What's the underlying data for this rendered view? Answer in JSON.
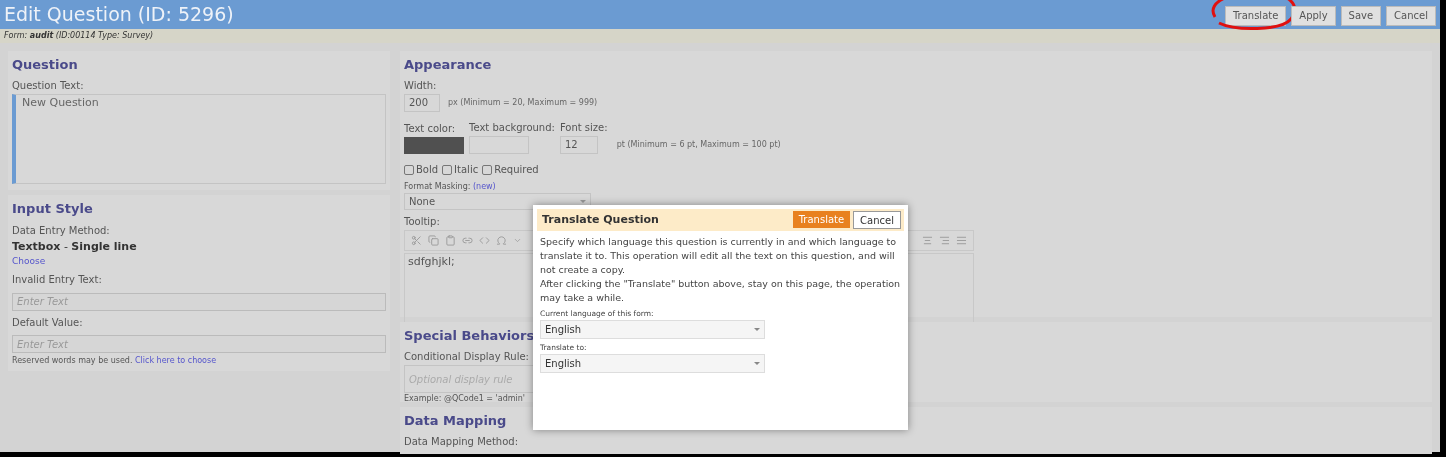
{
  "header": {
    "title": "Edit Question (ID: 5296)",
    "buttons": [
      {
        "label": "Translate",
        "circled": true
      },
      {
        "label": "Apply",
        "circled": false
      },
      {
        "label": "Save",
        "circled": false
      },
      {
        "label": "Cancel",
        "circled": false
      }
    ]
  },
  "form_info": "Form: **audit** (ID:00114  Type: Survey)",
  "question": {
    "heading": "Question",
    "label": "Question Text:",
    "value": "New Question"
  },
  "input_style": {
    "heading": "Input Style",
    "method_label": "Data Entry Method:",
    "method_bold": "Textbox",
    "method_sep": " - ",
    "method_rest": "Single line",
    "choose_link": "Choose",
    "invalid_label": "Invalid Entry Text:",
    "invalid_placeholder": "Enter Text",
    "default_label": "Default Value:",
    "default_placeholder": "Enter Text",
    "reserved_note": "Reserved words may be used.",
    "reserved_link": "Click here to choose"
  },
  "appearance": {
    "heading": "Appearance",
    "width_label": "Width:",
    "width_value": "200",
    "width_hint": "px (Minimum = 20, Maximum = 999)",
    "text_color_label": "Text color:",
    "text_bg_label": "Text background:",
    "font_size_label": "Font size:",
    "font_size_value": "12",
    "font_size_hint": "pt (Minimum = 6 pt, Maximum = 100 pt)",
    "options": [
      {
        "label": "Bold",
        "checked": false
      },
      {
        "label": "Italic",
        "checked": false
      },
      {
        "label": "Required",
        "checked": false
      }
    ],
    "masking_label": "Format Masking:",
    "masking_link": "(new)",
    "masking_value": "None",
    "tooltip_label": "Tooltip:",
    "tooltip_value": "sdfghjkl;"
  },
  "special": {
    "heading": "Special Behaviors",
    "rule_label": "Conditional Display Rule:",
    "rule_placeholder": "Optional display rule",
    "example": "Example: @QCode1 = 'admin'"
  },
  "data_mapping": {
    "heading": "Data Mapping",
    "method_label": "Data Mapping Method:"
  },
  "dialog": {
    "title": "Translate Question",
    "primary": "Translate",
    "cancel": "Cancel",
    "text1": "Specify which language this question is currently in and which language to translate it to. This operation will edit all the text on this question, and will not create a copy.",
    "text2": "After clicking the \"Translate\" button above, stay on this page, the operation may take a while.",
    "current_label": "Current language of this form:",
    "current_value": "English",
    "target_label": "Translate to:",
    "target_value": "English"
  }
}
